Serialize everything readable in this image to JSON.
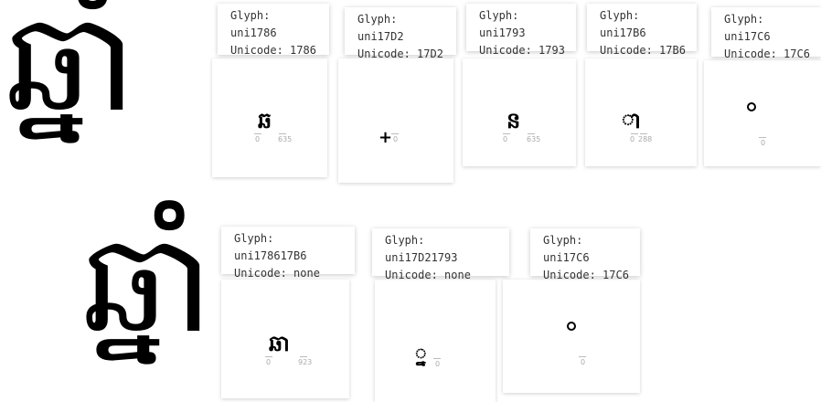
{
  "rows": [
    {
      "big_text": "ឆ្នាំ",
      "cards": [
        {
          "glyph_label": "Glyph: uni1786",
          "unicode_label": "Unicode: 1786",
          "glyph": "ឆ",
          "metrics": [
            "0",
            "635"
          ]
        },
        {
          "glyph_label": "Glyph: uni17D2",
          "unicode_label": "Unicode: 17D2",
          "glyph": "+",
          "metrics": [
            "0"
          ]
        },
        {
          "glyph_label": "Glyph: uni1793",
          "unicode_label": "Unicode: 1793",
          "glyph": "ន",
          "metrics": [
            "0",
            "635"
          ]
        },
        {
          "glyph_label": "Glyph: uni17B6",
          "unicode_label": "Unicode: 17B6",
          "glyph": "ា",
          "metrics": [
            "0",
            "288"
          ]
        },
        {
          "glyph_label": "Glyph: uni17C6",
          "unicode_label": "Unicode: 17C6",
          "glyph": "",
          "metrics": [
            "0"
          ]
        }
      ]
    },
    {
      "big_text": "ឆ្នាំ",
      "cards": [
        {
          "glyph_label": "Glyph: uni178617B6",
          "unicode_label": "Unicode: none",
          "glyph": "ឆា",
          "metrics": [
            "0",
            "923"
          ]
        },
        {
          "glyph_label": "Glyph: uni17D21793",
          "unicode_label": "Unicode: none",
          "glyph": "្ន",
          "metrics": [
            "0"
          ]
        },
        {
          "glyph_label": "Glyph: uni17C6",
          "unicode_label": "Unicode: 17C6",
          "glyph": "",
          "metrics": [
            "0"
          ]
        }
      ]
    }
  ]
}
